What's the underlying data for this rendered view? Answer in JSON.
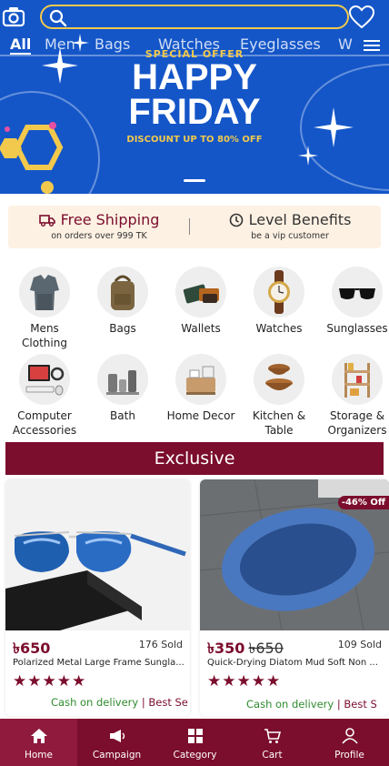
{
  "header": {
    "search_placeholder": "",
    "icons": [
      "camera-icon",
      "search-icon",
      "heart-icon",
      "menu-icon"
    ]
  },
  "tabs": [
    {
      "label": "All",
      "active": true
    },
    {
      "label": "Men"
    },
    {
      "label": "Bags"
    },
    {
      "label": "Watches"
    },
    {
      "label": "Eyeglasses"
    },
    {
      "label": "W"
    }
  ],
  "banner": {
    "special": "SPECIAL OFFER",
    "title_line1": "HAPPY",
    "title_line2": "FRIDAY",
    "discount": "DISCOUNT UP TO 80% OFF"
  },
  "benefits": [
    {
      "title": "Free Shipping",
      "subtitle": "on orders over 999 TK",
      "icon": "truck-icon"
    },
    {
      "title": "Level Benefits",
      "subtitle": "be a vip customer",
      "icon": "clock-icon"
    }
  ],
  "categories": [
    {
      "label": "Mens Clothing",
      "icon": "clothing-icon"
    },
    {
      "label": "Bags",
      "icon": "bag-icon"
    },
    {
      "label": "Wallets",
      "icon": "wallet-icon"
    },
    {
      "label": "Watches",
      "icon": "watch-icon"
    },
    {
      "label": "Sunglasses",
      "icon": "sunglasses-icon"
    },
    {
      "label": "Computer Accessories",
      "icon": "computer-icon"
    },
    {
      "label": "Bath",
      "icon": "bath-icon"
    },
    {
      "label": "Home Decor",
      "icon": "decor-icon"
    },
    {
      "label": "Kitchen & Table",
      "icon": "bowl-icon"
    },
    {
      "label": "Storage & Organizers",
      "icon": "shelf-icon"
    }
  ],
  "section_title": "Exclusive",
  "products": [
    {
      "price": "৳650",
      "old_price": "",
      "sold": "176 Sold",
      "name": "Polarized Metal Large Frame Sungla...",
      "stars": "★★★★★",
      "cod": "Cash on delivery",
      "best": "| Best Se",
      "badge": ""
    },
    {
      "price": "৳350",
      "old_price": "৳650",
      "sold": "109 Sold",
      "name": "Quick-Drying Diatom Mud Soft Non ...",
      "stars": "★★★★★",
      "cod": "Cash on delivery",
      "best": "| Best S",
      "badge": "-46% Off"
    }
  ],
  "bottom_nav": [
    {
      "label": "Home",
      "icon": "home-icon",
      "active": true
    },
    {
      "label": "Campaign",
      "icon": "megaphone-icon"
    },
    {
      "label": "Category",
      "icon": "grid-icon"
    },
    {
      "label": "Cart",
      "icon": "cart-icon"
    },
    {
      "label": "Profile",
      "icon": "user-icon"
    }
  ],
  "colors": {
    "brand": "#7b0d2d",
    "banner": "#1456c8",
    "accent": "#f2c94c",
    "green": "#2e8b2e"
  }
}
